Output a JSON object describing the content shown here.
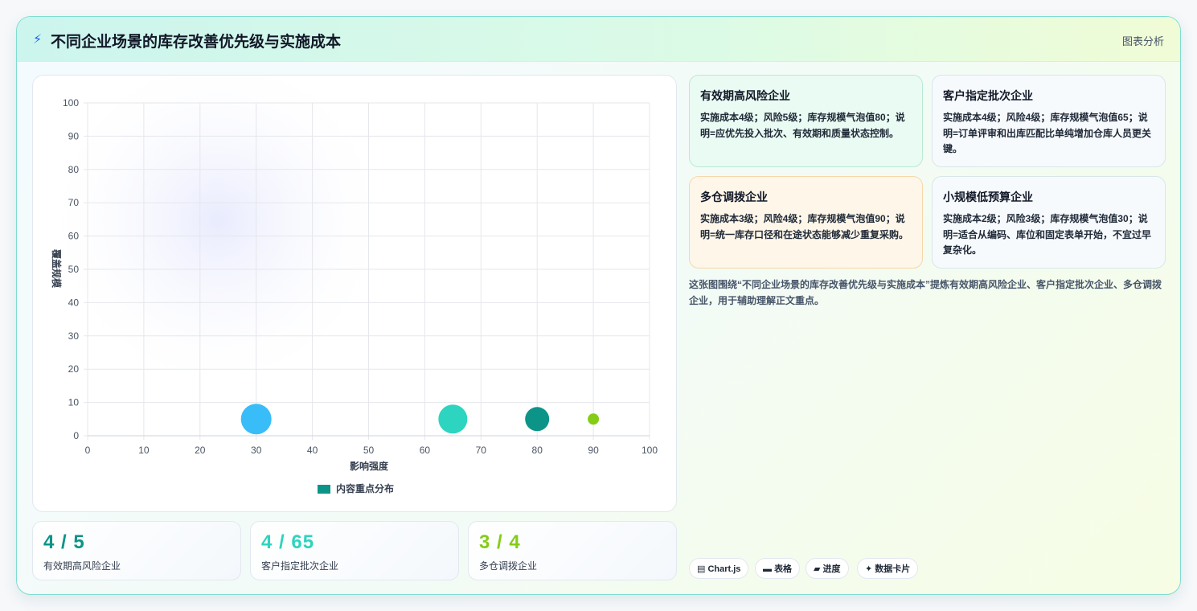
{
  "header": {
    "icon": "lightning-icon",
    "title": "不同企业场景的库存改善优先级与实施成本",
    "tag": "图表分析"
  },
  "chart_data": {
    "type": "bubble",
    "xlabel": "影响强度",
    "ylabel": "覆盖规模",
    "xlim": [
      0,
      100
    ],
    "ylim": [
      0,
      100
    ],
    "x_ticks": [
      0,
      10,
      20,
      30,
      40,
      50,
      60,
      70,
      80,
      90,
      100
    ],
    "y_ticks": [
      0,
      10,
      20,
      30,
      40,
      50,
      60,
      70,
      80,
      90,
      100
    ],
    "grid": true,
    "legend_position": "bottom",
    "series": [
      {
        "name": "内容重点分布",
        "color": "#0d9488",
        "points": [
          {
            "x": 30,
            "y": 5,
            "r": 19,
            "color": "#38bdf8"
          },
          {
            "x": 65,
            "y": 5,
            "r": 18,
            "color": "#2dd4bf"
          },
          {
            "x": 80,
            "y": 5,
            "r": 15,
            "color": "#0d9488"
          },
          {
            "x": 90,
            "y": 5,
            "r": 7,
            "color": "#84cc16"
          }
        ]
      }
    ]
  },
  "stats": [
    {
      "value": "4 / 5",
      "label": "有效期高风险企业",
      "color": "#0d9488"
    },
    {
      "value": "4 / 65",
      "label": "客户指定批次企业",
      "color": "#2dd4bf"
    },
    {
      "value": "3 / 4",
      "label": "多仓调拨企业",
      "color": "#84cc16"
    }
  ],
  "cards": [
    {
      "title": "有效期高风险企业",
      "body": "实施成本4级；风险5级；库存规模气泡值80；说明=应优先投入批次、有效期和质量状态控制。"
    },
    {
      "title": "客户指定批次企业",
      "body": "实施成本4级；风险4级；库存规模气泡值65；说明=订单评审和出库匹配比单纯增加仓库人员更关键。"
    },
    {
      "title": "多仓调拨企业",
      "body": "实施成本3级；风险4级；库存规模气泡值90；说明=统一库存口径和在途状态能够减少重复采购。"
    },
    {
      "title": "小规模低预算企业",
      "body": "实施成本2级；风险3级；库存规模气泡值30；说明=适合从编码、库位和固定表单开始，不宜过早复杂化。"
    }
  ],
  "description": "这张图围绕“不同企业场景的库存改善优先级与实施成本”提炼有效期高风险企业、客户指定批次企业、多仓调拨企业，用于辅助理解正文重点。",
  "chips": [
    {
      "icon": "chart-icon",
      "glyph": "▤",
      "label": "Chart.js"
    },
    {
      "icon": "table-icon",
      "glyph": "▬",
      "label": "表格"
    },
    {
      "icon": "progress-icon",
      "glyph": "▰",
      "label": "进度"
    },
    {
      "icon": "sparkle-icon",
      "glyph": "✦",
      "label": "数据卡片"
    }
  ]
}
